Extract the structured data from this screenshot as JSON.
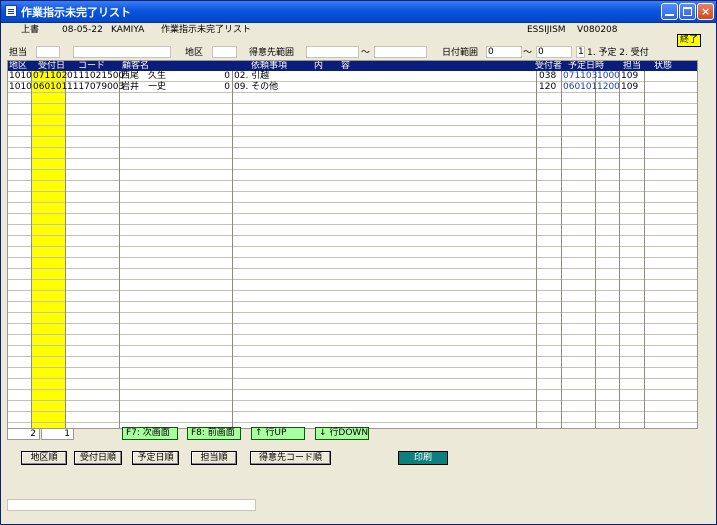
{
  "window": {
    "title": "作業指示未完了リスト",
    "buttons": {
      "minimize": "minimize-icon",
      "maximize": "maximize-icon",
      "close": "close-icon"
    }
  },
  "header": {
    "mode": "上書",
    "date": "08-05-22",
    "user": "KAMIYA",
    "screen_title": "作業指示未完了リスト",
    "program_id": "ESSIJISM",
    "version": "V080208",
    "exit_label": "終了"
  },
  "filters": {
    "tanto_label": "担当",
    "tanto_value": "",
    "tanto_name": "",
    "chiku_label": "地区",
    "chiku_value": "",
    "tokuisaki_label": "得意先範囲",
    "tokuisaki_from": "",
    "tilde1": "～",
    "tokuisaki_to": "",
    "date_label": "日付範囲",
    "date_from": "0",
    "tilde2": "～",
    "date_to": "0",
    "type_value": "1",
    "type_options": "1. 予定 2. 受付"
  },
  "table": {
    "columns": [
      "地区",
      "受付日",
      "コード",
      "顧客名",
      "依頼事項　　　内　　容",
      "受付者",
      "予定日時",
      "担当",
      "状態"
    ],
    "rows": [
      {
        "chiku": "1010",
        "uketsukebi": "071102",
        "code": "0111021500",
        "kokyaku": "西尾　久生",
        "num": "0",
        "irai": "02. 引越",
        "uketsukesha": "038",
        "yotei_date": "071103",
        "yotei_time": "1000",
        "tanto": "109",
        "jotai": ""
      },
      {
        "chiku": "1010",
        "uketsukebi": "060101",
        "code": "1117079003",
        "kokyaku": "岩井　一史",
        "num": "0",
        "irai": "09. その他",
        "uketsukesha": "120",
        "yotei_date": "060101",
        "yotei_time": "1200",
        "tanto": "109",
        "jotai": ""
      }
    ]
  },
  "footer": {
    "count_a": "2",
    "count_b": "1",
    "f7_label": "F7: 次画面",
    "f8_label": "F8: 前画面",
    "row_up_label": "↑ 行UP",
    "row_down_label": "↓ 行DOWN",
    "sort_buttons": [
      "地区順",
      "受付日順",
      "予定日順",
      "担当順",
      "得意先コード順"
    ],
    "print_label": "印刷",
    "status_text": ""
  },
  "colors": {
    "header_bg": "#0a1d7a",
    "highlight_yellow": "#ffff00",
    "nav_green": "#a9ffa0",
    "print_teal": "#0e7f7f",
    "time_blue": "#1a3fb0"
  }
}
